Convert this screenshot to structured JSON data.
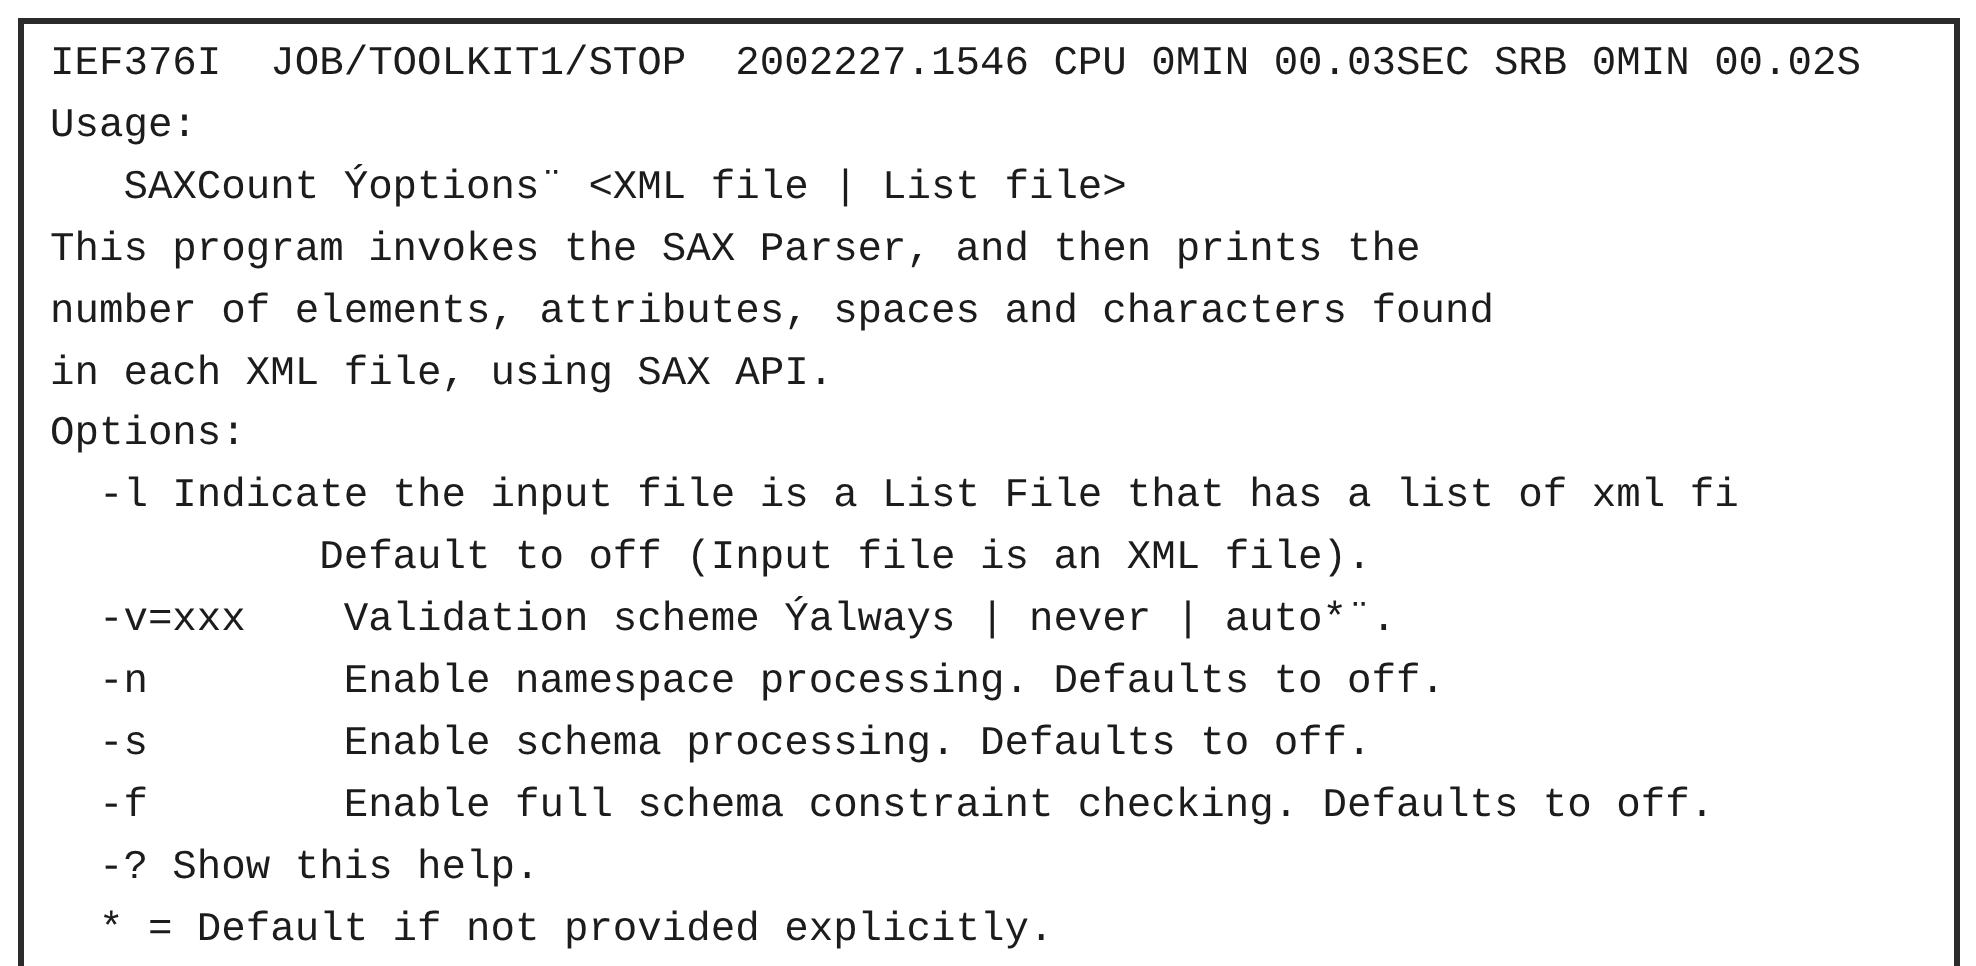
{
  "console": {
    "lines": [
      "IEF376I  JOB/TOOLKIT1/STOP  2002227.1546 CPU 0MIN 00.03SEC SRB 0MIN 00.02S",
      "Usage:",
      "   SAXCount Ýoptions¨ <XML file | List file>",
      "This program invokes the SAX Parser, and then prints the",
      "number of elements, attributes, spaces and characters found",
      "in each XML file, using SAX API.",
      "Options:",
      "  -l Indicate the input file is a List File that has a list of xml fi",
      "           Default to off (Input file is an XML file).",
      "  -v=xxx    Validation scheme Ýalways | never | auto*¨.",
      "  -n        Enable namespace processing. Defaults to off.",
      "  -s        Enable schema processing. Defaults to off.",
      "  -f        Enable full schema constraint checking. Defaults to off.",
      "  -? Show this help.",
      "  * = Default if not provided explicitly."
    ]
  }
}
